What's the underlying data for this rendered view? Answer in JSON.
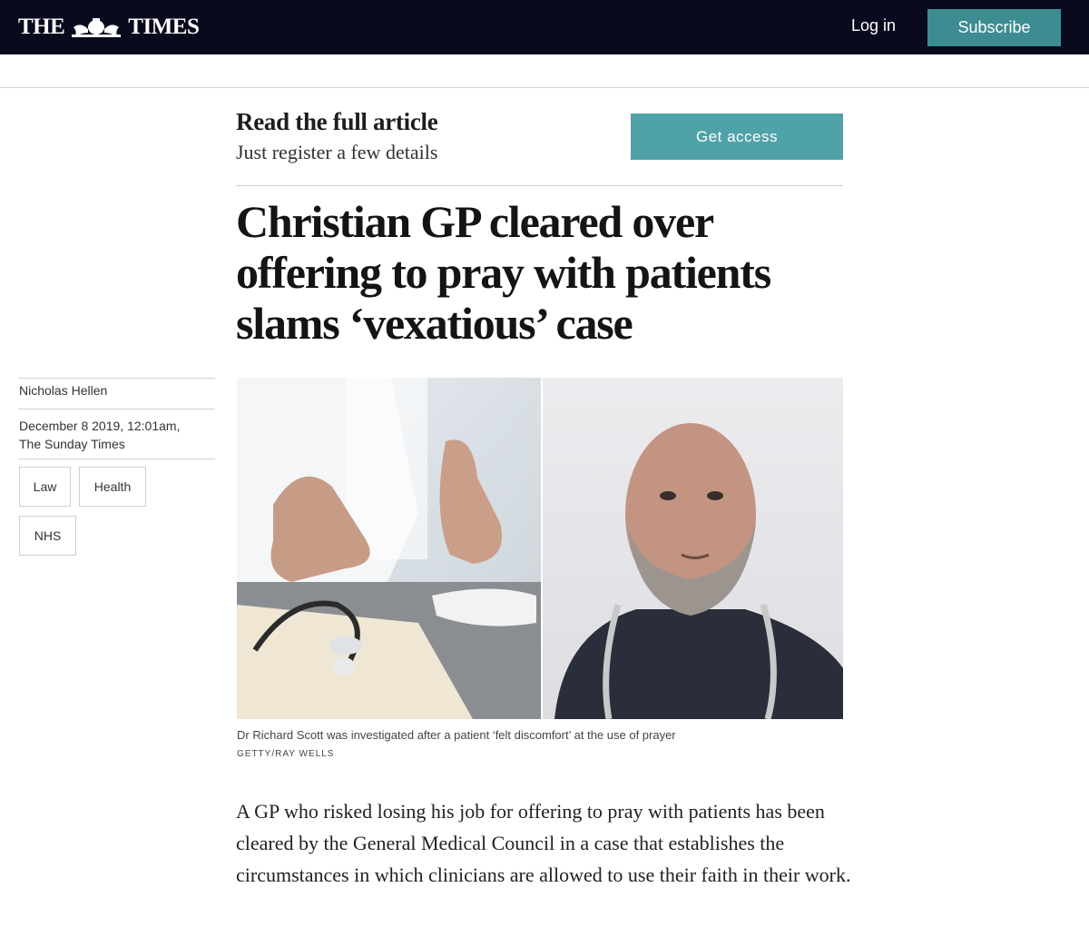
{
  "header": {
    "logo_left": "THE",
    "logo_right": "TIMES",
    "login_label": "Log in",
    "subscribe_label": "Subscribe"
  },
  "promo": {
    "title": "Read the full article",
    "subtitle": "Just register a few details",
    "cta_label": "Get access"
  },
  "article": {
    "headline": "Christian GP cleared over offering to pray with patients slams ‘vexatious’ case",
    "author": "Nicholas Hellen",
    "date": "December 8 2019, 12:01am,",
    "publication": "The Sunday Times",
    "tags": [
      "Law",
      "Health",
      "NHS"
    ],
    "caption": "Dr Richard Scott was investigated after a patient ‘felt discomfort’ at the use of prayer",
    "credit": "GETTY/RAY WELLS",
    "body": "A GP who risked losing his job for offering to pray with patients has been cleared by the General Medical Council in a case that establishes the circumstances in which clinicians are allowed to use their faith in their work."
  },
  "colors": {
    "nav_bg": "#0a0a1e",
    "subscribe_bg": "#3c8c92",
    "access_bg": "#4fa2a7"
  }
}
